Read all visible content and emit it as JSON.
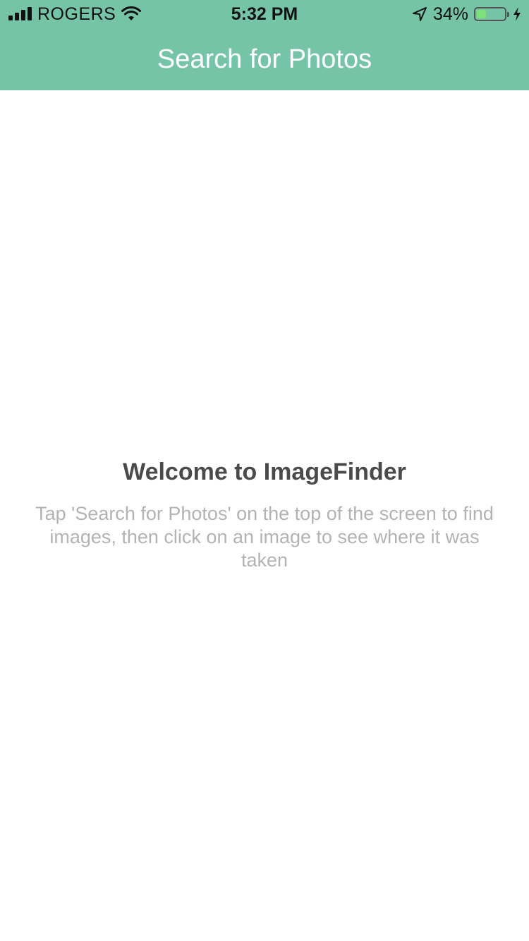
{
  "status_bar": {
    "carrier": "ROGERS",
    "time": "5:32 PM",
    "battery_percent_label": "34%",
    "battery_level": 0.34,
    "icons": [
      "signal-icon",
      "wifi-icon",
      "location-arrow-icon",
      "battery-icon",
      "charging-bolt-icon"
    ]
  },
  "nav": {
    "title": "Search for Photos",
    "background_color": "#76c4a8"
  },
  "welcome": {
    "title": "Welcome to ImageFinder",
    "message": "Tap 'Search for Photos' on the top of the screen to find images, then click on an image to see where it was taken"
  }
}
